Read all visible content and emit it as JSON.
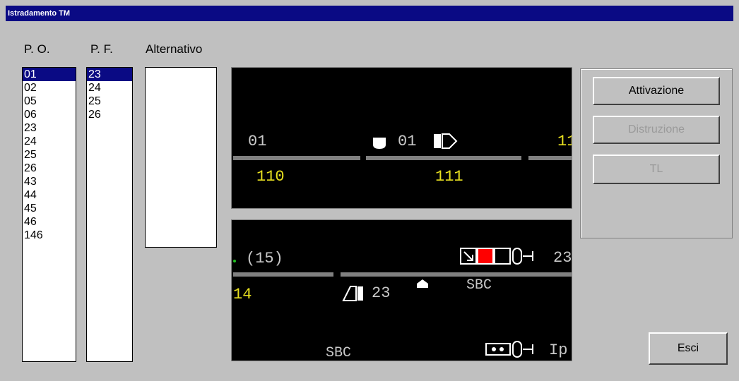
{
  "window": {
    "title": "Istradamento TM"
  },
  "columns": {
    "po": "P. O.",
    "pf": "P. F.",
    "alt": "Alternativo"
  },
  "po_list": [
    "01",
    "02",
    "05",
    "06",
    "23",
    "24",
    "25",
    "26",
    "43",
    "44",
    "45",
    "46",
    "146"
  ],
  "pf_list": [
    "23",
    "24",
    "25",
    "26"
  ],
  "panel_top": {
    "left_label": "01",
    "signal_label": "01",
    "right_label": "11",
    "track_a": "110",
    "track_b": "111"
  },
  "panel_bottom": {
    "label_15": "(15)",
    "right_label": "23",
    "label_14": "14",
    "label_23": "23",
    "sbc_1": "SBC",
    "sbc_2": "SBC",
    "ip": "Ip"
  },
  "buttons": {
    "attivazione": "Attivazione",
    "distruzione": "Distruzione",
    "tl": "TL",
    "esci": "Esci"
  },
  "colors": {
    "title_bg": "#0a0a84",
    "yellow_text": "#e8e020",
    "grey_text": "#c8c8c8",
    "red_block": "#ff0000"
  }
}
